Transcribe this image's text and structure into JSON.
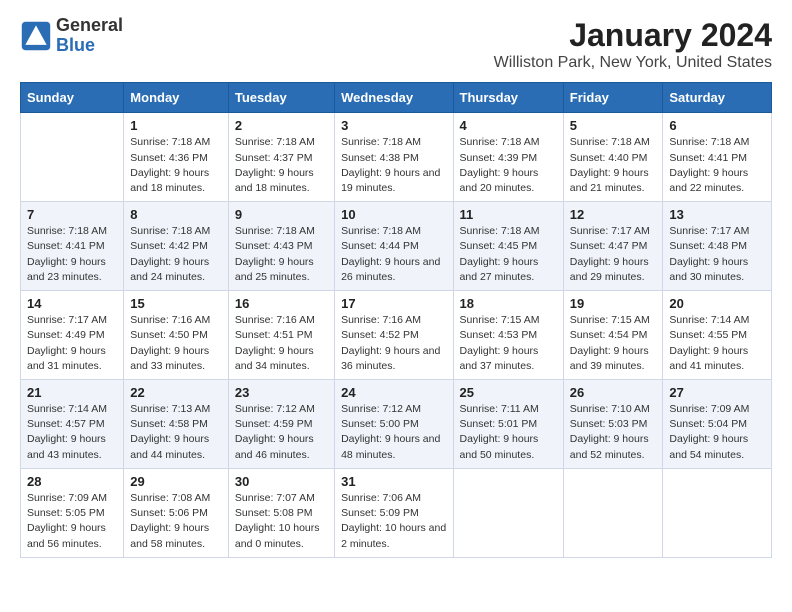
{
  "logo": {
    "general": "General",
    "blue": "Blue"
  },
  "title": "January 2024",
  "subtitle": "Williston Park, New York, United States",
  "days": [
    "Sunday",
    "Monday",
    "Tuesday",
    "Wednesday",
    "Thursday",
    "Friday",
    "Saturday"
  ],
  "weeks": [
    [
      {
        "date": "",
        "sunrise": "",
        "sunset": "",
        "daylight": ""
      },
      {
        "date": "1",
        "sunrise": "Sunrise: 7:18 AM",
        "sunset": "Sunset: 4:36 PM",
        "daylight": "Daylight: 9 hours and 18 minutes."
      },
      {
        "date": "2",
        "sunrise": "Sunrise: 7:18 AM",
        "sunset": "Sunset: 4:37 PM",
        "daylight": "Daylight: 9 hours and 18 minutes."
      },
      {
        "date": "3",
        "sunrise": "Sunrise: 7:18 AM",
        "sunset": "Sunset: 4:38 PM",
        "daylight": "Daylight: 9 hours and 19 minutes."
      },
      {
        "date": "4",
        "sunrise": "Sunrise: 7:18 AM",
        "sunset": "Sunset: 4:39 PM",
        "daylight": "Daylight: 9 hours and 20 minutes."
      },
      {
        "date": "5",
        "sunrise": "Sunrise: 7:18 AM",
        "sunset": "Sunset: 4:40 PM",
        "daylight": "Daylight: 9 hours and 21 minutes."
      },
      {
        "date": "6",
        "sunrise": "Sunrise: 7:18 AM",
        "sunset": "Sunset: 4:41 PM",
        "daylight": "Daylight: 9 hours and 22 minutes."
      }
    ],
    [
      {
        "date": "7",
        "sunrise": "Sunrise: 7:18 AM",
        "sunset": "Sunset: 4:41 PM",
        "daylight": "Daylight: 9 hours and 23 minutes."
      },
      {
        "date": "8",
        "sunrise": "Sunrise: 7:18 AM",
        "sunset": "Sunset: 4:42 PM",
        "daylight": "Daylight: 9 hours and 24 minutes."
      },
      {
        "date": "9",
        "sunrise": "Sunrise: 7:18 AM",
        "sunset": "Sunset: 4:43 PM",
        "daylight": "Daylight: 9 hours and 25 minutes."
      },
      {
        "date": "10",
        "sunrise": "Sunrise: 7:18 AM",
        "sunset": "Sunset: 4:44 PM",
        "daylight": "Daylight: 9 hours and 26 minutes."
      },
      {
        "date": "11",
        "sunrise": "Sunrise: 7:18 AM",
        "sunset": "Sunset: 4:45 PM",
        "daylight": "Daylight: 9 hours and 27 minutes."
      },
      {
        "date": "12",
        "sunrise": "Sunrise: 7:17 AM",
        "sunset": "Sunset: 4:47 PM",
        "daylight": "Daylight: 9 hours and 29 minutes."
      },
      {
        "date": "13",
        "sunrise": "Sunrise: 7:17 AM",
        "sunset": "Sunset: 4:48 PM",
        "daylight": "Daylight: 9 hours and 30 minutes."
      }
    ],
    [
      {
        "date": "14",
        "sunrise": "Sunrise: 7:17 AM",
        "sunset": "Sunset: 4:49 PM",
        "daylight": "Daylight: 9 hours and 31 minutes."
      },
      {
        "date": "15",
        "sunrise": "Sunrise: 7:16 AM",
        "sunset": "Sunset: 4:50 PM",
        "daylight": "Daylight: 9 hours and 33 minutes."
      },
      {
        "date": "16",
        "sunrise": "Sunrise: 7:16 AM",
        "sunset": "Sunset: 4:51 PM",
        "daylight": "Daylight: 9 hours and 34 minutes."
      },
      {
        "date": "17",
        "sunrise": "Sunrise: 7:16 AM",
        "sunset": "Sunset: 4:52 PM",
        "daylight": "Daylight: 9 hours and 36 minutes."
      },
      {
        "date": "18",
        "sunrise": "Sunrise: 7:15 AM",
        "sunset": "Sunset: 4:53 PM",
        "daylight": "Daylight: 9 hours and 37 minutes."
      },
      {
        "date": "19",
        "sunrise": "Sunrise: 7:15 AM",
        "sunset": "Sunset: 4:54 PM",
        "daylight": "Daylight: 9 hours and 39 minutes."
      },
      {
        "date": "20",
        "sunrise": "Sunrise: 7:14 AM",
        "sunset": "Sunset: 4:55 PM",
        "daylight": "Daylight: 9 hours and 41 minutes."
      }
    ],
    [
      {
        "date": "21",
        "sunrise": "Sunrise: 7:14 AM",
        "sunset": "Sunset: 4:57 PM",
        "daylight": "Daylight: 9 hours and 43 minutes."
      },
      {
        "date": "22",
        "sunrise": "Sunrise: 7:13 AM",
        "sunset": "Sunset: 4:58 PM",
        "daylight": "Daylight: 9 hours and 44 minutes."
      },
      {
        "date": "23",
        "sunrise": "Sunrise: 7:12 AM",
        "sunset": "Sunset: 4:59 PM",
        "daylight": "Daylight: 9 hours and 46 minutes."
      },
      {
        "date": "24",
        "sunrise": "Sunrise: 7:12 AM",
        "sunset": "Sunset: 5:00 PM",
        "daylight": "Daylight: 9 hours and 48 minutes."
      },
      {
        "date": "25",
        "sunrise": "Sunrise: 7:11 AM",
        "sunset": "Sunset: 5:01 PM",
        "daylight": "Daylight: 9 hours and 50 minutes."
      },
      {
        "date": "26",
        "sunrise": "Sunrise: 7:10 AM",
        "sunset": "Sunset: 5:03 PM",
        "daylight": "Daylight: 9 hours and 52 minutes."
      },
      {
        "date": "27",
        "sunrise": "Sunrise: 7:09 AM",
        "sunset": "Sunset: 5:04 PM",
        "daylight": "Daylight: 9 hours and 54 minutes."
      }
    ],
    [
      {
        "date": "28",
        "sunrise": "Sunrise: 7:09 AM",
        "sunset": "Sunset: 5:05 PM",
        "daylight": "Daylight: 9 hours and 56 minutes."
      },
      {
        "date": "29",
        "sunrise": "Sunrise: 7:08 AM",
        "sunset": "Sunset: 5:06 PM",
        "daylight": "Daylight: 9 hours and 58 minutes."
      },
      {
        "date": "30",
        "sunrise": "Sunrise: 7:07 AM",
        "sunset": "Sunset: 5:08 PM",
        "daylight": "Daylight: 10 hours and 0 minutes."
      },
      {
        "date": "31",
        "sunrise": "Sunrise: 7:06 AM",
        "sunset": "Sunset: 5:09 PM",
        "daylight": "Daylight: 10 hours and 2 minutes."
      },
      {
        "date": "",
        "sunrise": "",
        "sunset": "",
        "daylight": ""
      },
      {
        "date": "",
        "sunrise": "",
        "sunset": "",
        "daylight": ""
      },
      {
        "date": "",
        "sunrise": "",
        "sunset": "",
        "daylight": ""
      }
    ]
  ]
}
